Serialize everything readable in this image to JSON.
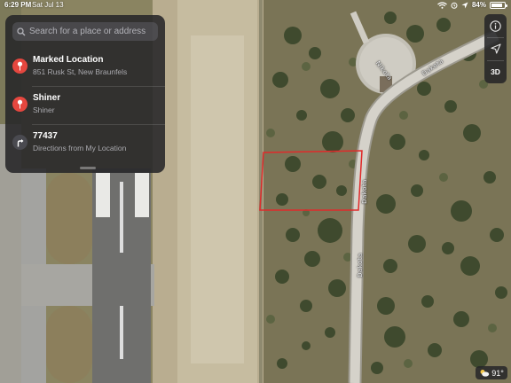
{
  "status_bar": {
    "time": "6:29 PM",
    "date": "Sat Jul 13",
    "battery_text": "84%",
    "battery_level": 0.84
  },
  "search": {
    "placeholder": "Search for a place or address",
    "icon": "magnifier"
  },
  "results": [
    {
      "title": "Marked Location",
      "subtitle": "851 Rusk St, New Braunfels",
      "icon": "red-pin",
      "color": "#e5473f"
    },
    {
      "title": "Shiner",
      "subtitle": "Shiner",
      "icon": "red-pin",
      "color": "#e5473f"
    },
    {
      "title": "77437",
      "subtitle": "Directions from My Location",
      "icon": "turn-arrow",
      "color": "#4a4a50"
    }
  ],
  "controls": {
    "info_icon": "info-circle",
    "location_icon": "location-arrow",
    "three_d_label": "3D"
  },
  "road_labels": {
    "road_a": "Dakota",
    "road_b": "Dakota",
    "road_c": "Nikota"
  },
  "weather": {
    "icon": "partly-cloudy",
    "temperature": "91°"
  },
  "colors": {
    "parcel_outline": "#e02a2a",
    "pin_red": "#e5473f"
  }
}
